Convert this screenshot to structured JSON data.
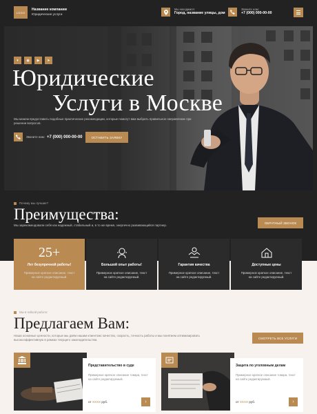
{
  "header": {
    "logo": "LOGO",
    "company_name": "Название компании",
    "company_sub": "Юридические услуги",
    "location_label": "Мы находимся:",
    "location_value": "Город, название улицы, дом",
    "phone_label": "Звоните нам:",
    "phone_value": "+7 (000) 000-00-00"
  },
  "hero": {
    "social": [
      "vk-icon",
      "whatsapp-icon",
      "youtube-icon",
      "telegram-icon"
    ],
    "title_line1": "Юридические",
    "title_line2": "Услуги в Москве",
    "description": "Мы можем предоставить подобные практические рекомендации, которые помогут вам выбрать правильное направление при решении вопросов.",
    "phone_label": "Звоните нам:",
    "phone_value": "+7 (000) 000-00-00",
    "cta": "ОСТАВИТЬ ЗАЯВКУ"
  },
  "advantages": {
    "label": "Почему мы лучшие?",
    "title": "Преимущества:",
    "description": "Мы зарекомендовали себя как надежный, стабильный и, в то же время, энергично развивающийся партнер.",
    "cta": "ОБРАТНЫЙ ЗВОНОК",
    "cards": [
      {
        "big": "25+",
        "title": "Лет безупречной работы!",
        "desc": "Примерное краткое описание, текст на сайте редактируемый."
      },
      {
        "title": "Большой опыт работы!",
        "desc": "Примерное краткое описание, текст на сайте редактируемый."
      },
      {
        "title": "Гарантия качества",
        "desc": "Примерное краткое описание, текст на сайте редактируемый."
      },
      {
        "title": "Доступные цены",
        "desc": "Примерное краткое описание, текст на сайте редактируемый."
      }
    ]
  },
  "offer": {
    "label": "Мы в гибкой работе:",
    "title": "Предлагаем Вам:",
    "description": "Наши основные ценности, которые мы даём нашим клиентам: качество, скорость, точность работы и мы понятием оптимизировать высокоэффективную в рамках текущего законодательства.",
    "cta": "СМОТРЕТЬ ВСЕ УСЛУГИ",
    "services": [
      {
        "title": "Представительство в суде",
        "desc": "Примерное краткое описание товара, текст на сайте редактируемый.",
        "price_prefix": "от",
        "price_value": "XXXX",
        "price_suffix": "руб."
      },
      {
        "title": "Защита по уголовным делам",
        "desc": "Примерное краткое описание товара, текст на сайте редактируемый.",
        "price_prefix": "от",
        "price_value": "XXXX",
        "price_suffix": "руб."
      }
    ]
  },
  "colors": {
    "accent": "#b98a52",
    "dark": "#222222",
    "light": "#f8f2ee"
  }
}
